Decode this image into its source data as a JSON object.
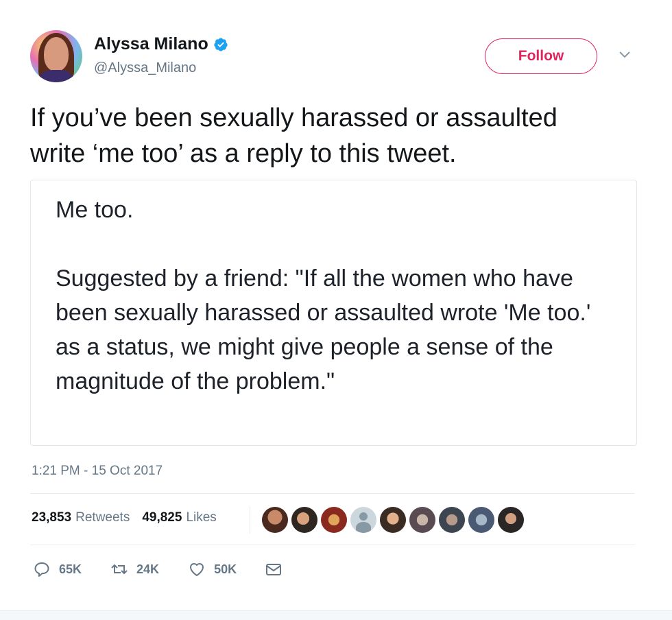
{
  "user": {
    "display_name": "Alyssa Milano",
    "handle": "@Alyssa_Milano",
    "verified": true
  },
  "follow_label": "Follow",
  "tweet": {
    "text_line1": "If you’ve been sexually harassed or assaulted",
    "text_line2": "write ‘me too’ as a reply to this tweet."
  },
  "image": {
    "paragraph1": "Me too.",
    "paragraph2": "Suggested by a friend: \"If all the women who have been sexually harassed or assaulted wrote 'Me too.' as a status, we might give people a sense of the magnitude of the problem.\""
  },
  "timestamp": "1:21 PM - 15 Oct 2017",
  "stats": {
    "retweets_count": "23,853",
    "retweets_label": "Retweets",
    "likes_count": "49,825",
    "likes_label": "Likes"
  },
  "actions": {
    "reply_count": "65K",
    "retweet_count": "24K",
    "like_count": "50K"
  },
  "icons": {
    "verified": "verified-badge-icon",
    "chevron": "chevron-down-icon",
    "reply": "reply-icon",
    "retweet": "retweet-icon",
    "like": "heart-icon",
    "message": "envelope-icon"
  },
  "colors": {
    "follow_accent": "#e0245e",
    "verified_blue": "#1da1f2",
    "secondary_text": "#657786",
    "primary_text": "#14171a"
  }
}
